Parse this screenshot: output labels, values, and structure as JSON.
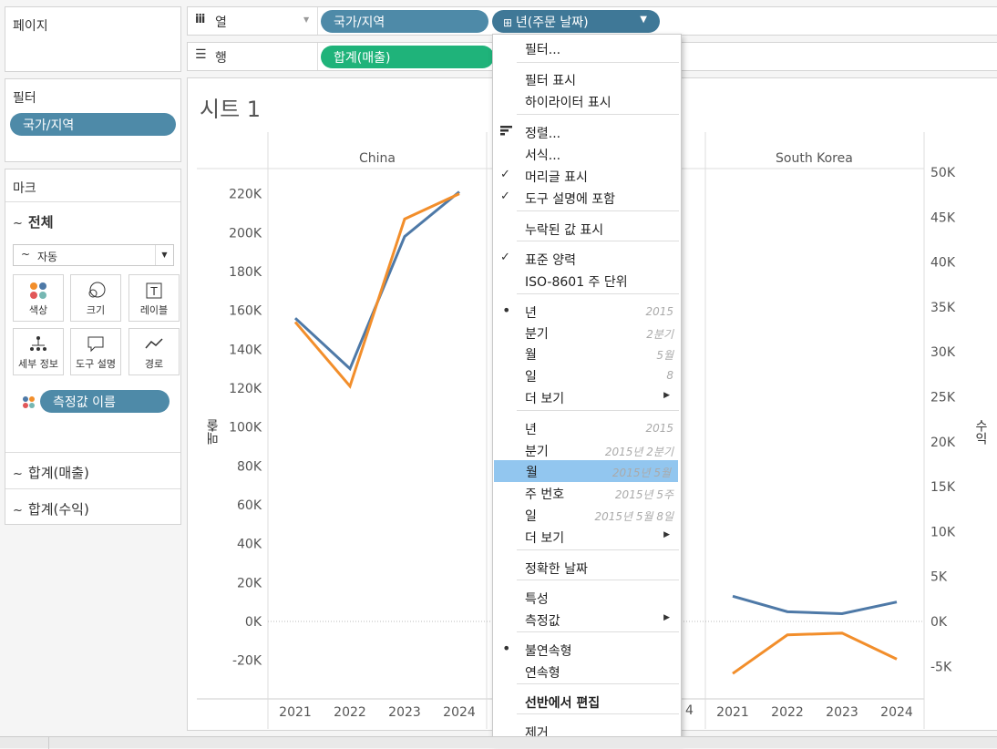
{
  "left": {
    "pages_title": "페이지",
    "filters_title": "필터",
    "filter_pill": "국가/지역",
    "marks_title": "마크",
    "all_label": "전체",
    "mark_type": "자동",
    "mark_buttons": [
      "색상",
      "크기",
      "레이블",
      "세부 정보",
      "도구 설명",
      "경로"
    ],
    "measure_pill": "측정값 이름",
    "sum_sales": "합계(매출)",
    "sum_profit": "합계(수익)"
  },
  "shelves": {
    "columns_label": "열",
    "rows_label": "행",
    "col_pill_1": "국가/지역",
    "col_pill_2": "년(주문 날짜)",
    "row_pill_1": "합계(매출)"
  },
  "sheet": {
    "title": "시트 1",
    "pane_left": "China",
    "pane_right": "South Korea",
    "left_axis_label": "매출",
    "right_axis_label": "수익",
    "hidden_year_partial": "4"
  },
  "menu": {
    "items": [
      {
        "label": "필터...",
        "sub": "",
        "mark": "",
        "arrow": false,
        "bold": false,
        "hl": false
      },
      {
        "label": "필터 표시",
        "sub": "",
        "mark": "",
        "arrow": false,
        "bold": false,
        "hl": false
      },
      {
        "label": "하이라이터 표시",
        "sub": "",
        "mark": "",
        "arrow": false,
        "bold": false,
        "hl": false
      },
      {
        "label": "정렬...",
        "sub": "",
        "mark": "sort",
        "arrow": false,
        "bold": false,
        "hl": false
      },
      {
        "label": "서식...",
        "sub": "",
        "mark": "",
        "arrow": false,
        "bold": false,
        "hl": false
      },
      {
        "label": "머리글 표시",
        "sub": "",
        "mark": "check",
        "arrow": false,
        "bold": false,
        "hl": false
      },
      {
        "label": "도구 설명에 포함",
        "sub": "",
        "mark": "check",
        "arrow": false,
        "bold": false,
        "hl": false
      },
      {
        "label": "누락된 값 표시",
        "sub": "",
        "mark": "",
        "arrow": false,
        "bold": false,
        "hl": false
      },
      {
        "label": "표준 양력",
        "sub": "",
        "mark": "check",
        "arrow": false,
        "bold": false,
        "hl": false
      },
      {
        "label": "ISO-8601 주 단위",
        "sub": "",
        "mark": "",
        "arrow": false,
        "bold": false,
        "hl": false
      },
      {
        "label": "년",
        "sub": "2015",
        "mark": "dot",
        "arrow": false,
        "bold": false,
        "hl": false
      },
      {
        "label": "분기",
        "sub": "2분기",
        "mark": "",
        "arrow": false,
        "bold": false,
        "hl": false
      },
      {
        "label": "월",
        "sub": "5월",
        "mark": "",
        "arrow": false,
        "bold": false,
        "hl": false
      },
      {
        "label": "일",
        "sub": "8",
        "mark": "",
        "arrow": false,
        "bold": false,
        "hl": false
      },
      {
        "label": "더 보기",
        "sub": "",
        "mark": "",
        "arrow": true,
        "bold": false,
        "hl": false
      },
      {
        "label": "년",
        "sub": "2015",
        "mark": "",
        "arrow": false,
        "bold": false,
        "hl": false
      },
      {
        "label": "분기",
        "sub": "2015년 2분기",
        "mark": "",
        "arrow": false,
        "bold": false,
        "hl": false
      },
      {
        "label": "월",
        "sub": "2015년 5월",
        "mark": "",
        "arrow": false,
        "bold": false,
        "hl": true
      },
      {
        "label": "주 번호",
        "sub": "2015년 5주",
        "mark": "",
        "arrow": false,
        "bold": false,
        "hl": false
      },
      {
        "label": "일",
        "sub": "2015년 5월 8일",
        "mark": "",
        "arrow": false,
        "bold": false,
        "hl": false
      },
      {
        "label": "더 보기",
        "sub": "",
        "mark": "",
        "arrow": true,
        "bold": false,
        "hl": false
      },
      {
        "label": "정확한 날짜",
        "sub": "",
        "mark": "",
        "arrow": false,
        "bold": false,
        "hl": false
      },
      {
        "label": "특성",
        "sub": "",
        "mark": "",
        "arrow": false,
        "bold": false,
        "hl": false
      },
      {
        "label": "측정값",
        "sub": "",
        "mark": "",
        "arrow": true,
        "bold": false,
        "hl": false
      },
      {
        "label": "불연속형",
        "sub": "",
        "mark": "dot",
        "arrow": false,
        "bold": false,
        "hl": false
      },
      {
        "label": "연속형",
        "sub": "",
        "mark": "",
        "arrow": false,
        "bold": false,
        "hl": false
      },
      {
        "label": "선반에서 편집",
        "sub": "",
        "mark": "",
        "arrow": false,
        "bold": true,
        "hl": false
      },
      {
        "label": "제거",
        "sub": "",
        "mark": "",
        "arrow": false,
        "bold": false,
        "hl": false
      }
    ]
  },
  "chart_data": {
    "type": "line",
    "colors": {
      "sales": "#4e79a7",
      "profit": "#f28e2b"
    },
    "left_axis": {
      "label": "매출",
      "ticks": [
        "-20K",
        "0K",
        "20K",
        "40K",
        "60K",
        "80K",
        "100K",
        "120K",
        "140K",
        "160K",
        "180K",
        "200K",
        "220K"
      ],
      "range": [
        -40000,
        230000
      ]
    },
    "right_axis": {
      "label": "수익",
      "ticks": [
        "-5K",
        "0K",
        "5K",
        "10K",
        "15K",
        "20K",
        "25K",
        "30K",
        "35K",
        "40K",
        "45K",
        "50K"
      ],
      "range": [
        -9000,
        51000
      ]
    },
    "x_ticks": [
      "2021",
      "2022",
      "2023",
      "2024"
    ],
    "panes": [
      {
        "name": "China",
        "series": [
          {
            "measure": "sales",
            "values": [
              156000,
              130000,
              198000,
              221000
            ]
          },
          {
            "measure": "sales_axis_profit",
            "values": [
              154000,
              121000,
              207000,
              220000
            ]
          }
        ]
      },
      {
        "name": "South Korea",
        "series": [
          {
            "measure": "sales",
            "values": [
              13000,
              5000,
              4000,
              10000
            ]
          },
          {
            "measure": "profit",
            "values": [
              -5800,
              -1500,
              -1300,
              -4200
            ]
          }
        ]
      }
    ]
  }
}
